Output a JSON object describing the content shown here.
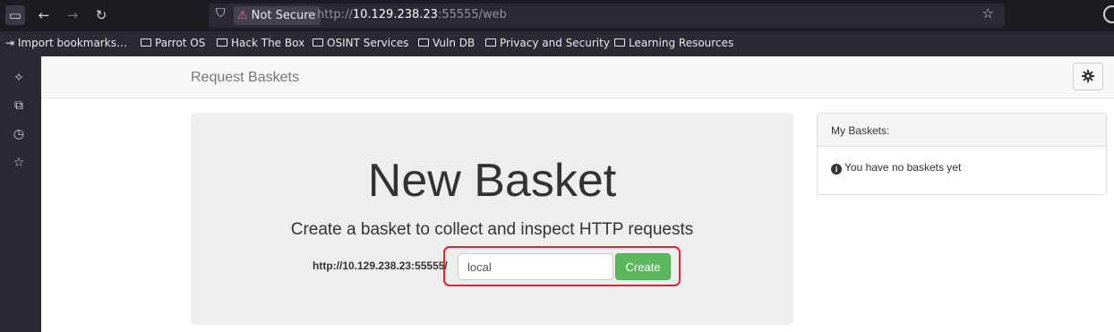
{
  "browser": {
    "url_scheme": "http://",
    "url_host": "10.129.238.23",
    "url_rest": ":55555/web",
    "security_label": "Not Secure",
    "bookmarks": [
      "Import bookmarks…",
      "Parrot OS",
      "Hack The Box",
      "OSINT Services",
      "Vuln DB",
      "Privacy and Security",
      "Learning Resources"
    ]
  },
  "navbar": {
    "brand": "Request Baskets",
    "settings_icon": "gear-icon"
  },
  "main": {
    "title": "New Basket",
    "subtitle": "Create a basket to collect and inspect HTTP requests",
    "url_prefix": "http://10.129.238.23:55555/",
    "basket_name_value": "local",
    "create_label": "Create",
    "highlight_color": "#e8212f"
  },
  "sidebar_panel": {
    "title": "My Baskets:",
    "empty_message": "You have no baskets yet"
  },
  "colors": {
    "create_button": "#5cb85c",
    "toolbar_bg": "#1c1b22",
    "bookmarks_bg": "#2b2a33"
  }
}
